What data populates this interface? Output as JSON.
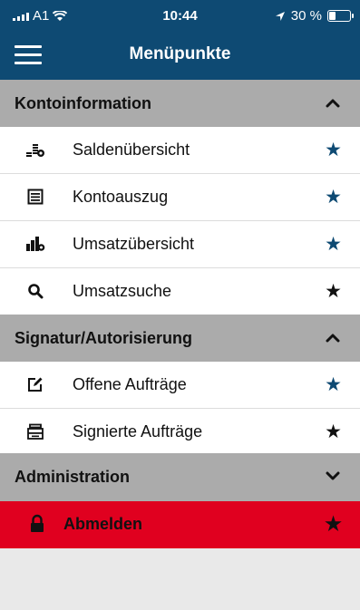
{
  "status": {
    "carrier": "A1",
    "time": "10:44",
    "battery": "30 %"
  },
  "nav": {
    "title": "Menüpunkte"
  },
  "sections": [
    {
      "title": "Kontoinformation",
      "expanded": true,
      "items": [
        {
          "label": "Saldenübersicht",
          "icon": "coins-icon",
          "favorite": true
        },
        {
          "label": "Kontoauszug",
          "icon": "statement-icon",
          "favorite": true
        },
        {
          "label": "Umsatzübersicht",
          "icon": "bars-coin-icon",
          "favorite": true
        },
        {
          "label": "Umsatzsuche",
          "icon": "search-icon",
          "favorite": false
        }
      ]
    },
    {
      "title": "Signatur/Autorisierung",
      "expanded": true,
      "items": [
        {
          "label": "Offene Aufträge",
          "icon": "edit-icon",
          "favorite": true
        },
        {
          "label": "Signierte Aufträge",
          "icon": "archive-icon",
          "favorite": false
        }
      ]
    },
    {
      "title": "Administration",
      "expanded": false
    }
  ],
  "logout": {
    "label": "Abmelden"
  },
  "colors": {
    "primary": "#0e4a73",
    "section": "#ababab",
    "logout": "#e0001f"
  }
}
